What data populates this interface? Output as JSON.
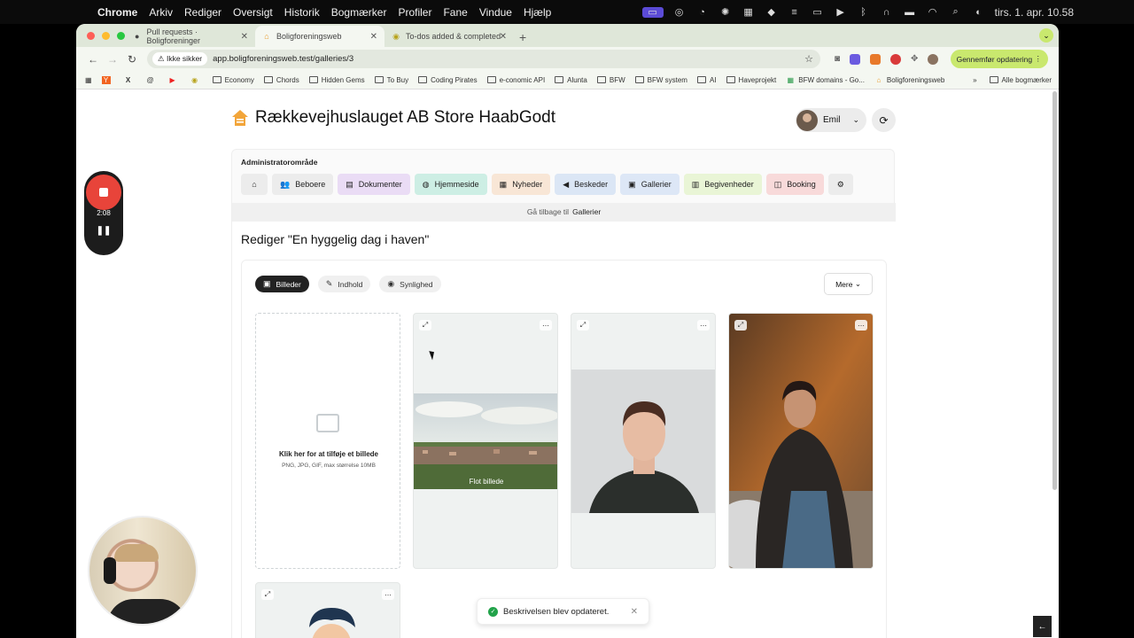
{
  "menubar": {
    "app": "Chrome",
    "items": [
      "Arkiv",
      "Rediger",
      "Oversigt",
      "Historik",
      "Bogmærker",
      "Profiler",
      "Fane",
      "Vindue",
      "Hjælp"
    ],
    "clock": "tirs. 1. apr.  10.58"
  },
  "browser": {
    "tabs": [
      {
        "title": "Pull requests · Boligforeninger",
        "icon": "github-icon"
      },
      {
        "title": "Boligforeningsweb",
        "icon": "house-icon"
      },
      {
        "title": "To-dos added & completed",
        "icon": "todo-icon"
      }
    ],
    "security": "Ikke sikker",
    "url": "app.boligforeningsweb.test/galleries/3",
    "update_button": "Gennemfør opdatering",
    "bookmarks": [
      "Y",
      "X",
      "",
      "",
      "",
      "Economy",
      "Chords",
      "Hidden Gems",
      "To Buy",
      "Coding Pirates",
      "e-conomic API",
      "Alunta",
      "BFW",
      "BFW system",
      "AI",
      "Haveprojekt",
      "BFW domains - Go...",
      "Boligforeningsweb"
    ],
    "all_bookmarks": "Alle bogmærker"
  },
  "page": {
    "title": "Rækkevejhuslauget AB Store HaabGodt",
    "user": "Emil",
    "admin_label": "Administratorområde",
    "nav": [
      {
        "label": "",
        "icon": "home-icon",
        "color": "#ececec"
      },
      {
        "label": "Beboere",
        "icon": "users-icon",
        "color": "#ececec"
      },
      {
        "label": "Dokumenter",
        "icon": "document-icon",
        "color": "#eadcf5"
      },
      {
        "label": "Hjemmeside",
        "icon": "globe-icon",
        "color": "#cdeee4"
      },
      {
        "label": "Nyheder",
        "icon": "news-icon",
        "color": "#f8e6d6"
      },
      {
        "label": "Beskeder",
        "icon": "megaphone-icon",
        "color": "#dbe6f5"
      },
      {
        "label": "Gallerier",
        "icon": "gallery-icon",
        "color": "#dde7f6"
      },
      {
        "label": "Begivenheder",
        "icon": "calendar-icon",
        "color": "#e9f5d6"
      },
      {
        "label": "Booking",
        "icon": "booking-icon",
        "color": "#f8dada"
      },
      {
        "label": "",
        "icon": "gear-icon",
        "color": "#ececec"
      }
    ],
    "back_prefix": "Gå tilbage til",
    "back_link": "Gallerier",
    "edit_title": "Rediger \"En hyggelig dag i haven\"",
    "tabs": [
      {
        "label": "Billeder",
        "icon": "image-icon",
        "active": true
      },
      {
        "label": "Indhold",
        "icon": "pencil-icon",
        "active": false
      },
      {
        "label": "Synlighed",
        "icon": "eye-icon",
        "active": false
      }
    ],
    "more_button": "Mere",
    "upload_title": "Klik her for at tilføje et billede",
    "upload_hint": "PNG, JPG, GIF, max størrelse 10MB",
    "image_caption": "Flot billede",
    "toast": "Beskrivelsen blev opdateret."
  },
  "recorder": {
    "time": "2:08"
  }
}
